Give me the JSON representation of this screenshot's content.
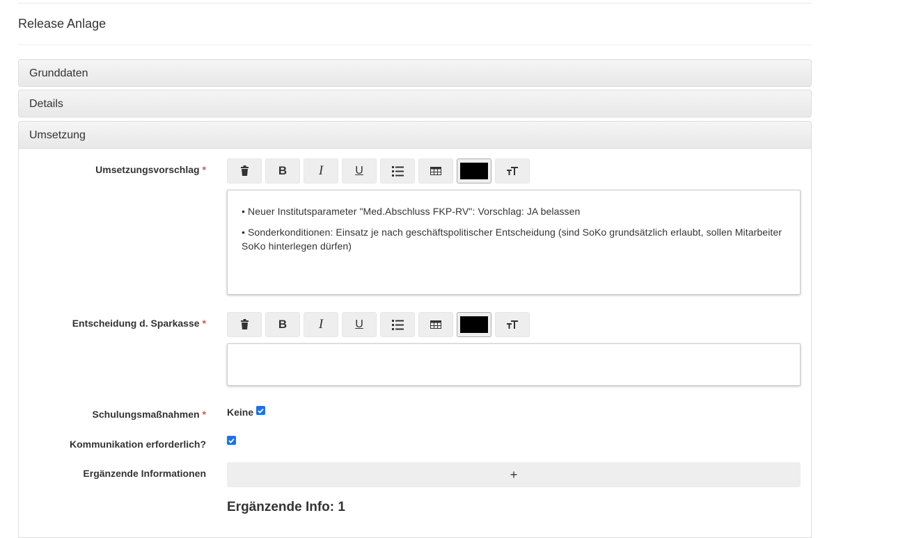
{
  "page": {
    "title": "Release Anlage"
  },
  "panels": {
    "grunddaten": "Grunddaten",
    "details": "Details",
    "umsetzung": "Umsetzung"
  },
  "fields": {
    "umsetzungsvorschlag": {
      "label": "Umsetzungsvorschlag",
      "required_mark": "*",
      "content": [
        "• Neuer Institutsparameter \"Med.Abschluss FKP-RV\": Vorschlag: JA belassen",
        "• Sonderkonditionen: Einsatz je nach geschäftspolitischer Entscheidung (sind SoKo grundsätzlich erlaubt, sollen Mitarbeiter SoKo hinterlegen dürfen)"
      ]
    },
    "entscheidung": {
      "label": "Entscheidung d. Sparkasse",
      "required_mark": "*",
      "content": ""
    },
    "schulung": {
      "label": "Schulungsmaßnahmen",
      "required_mark": "*",
      "option_label": "Keine",
      "checked": true
    },
    "kommunikation": {
      "label": "Kommunikation erforderlich?",
      "checked": true
    },
    "ergaenzende": {
      "label": "Ergänzende Informationen",
      "add_label": "+",
      "info_heading": "Ergänzende Info: 1"
    }
  },
  "toolbar": {
    "icons": [
      "trash-icon",
      "bold-icon",
      "italic-icon",
      "underline-icon",
      "list-icon",
      "table-icon",
      "color-swatch",
      "text-size-icon"
    ],
    "bold_label": "B",
    "italic_label": "I",
    "underline_label": "U",
    "color_value": "#000000"
  },
  "colors": {
    "required": "#d9534f",
    "checkbox": "#1a73e8",
    "panel_bg": "#ececec"
  }
}
